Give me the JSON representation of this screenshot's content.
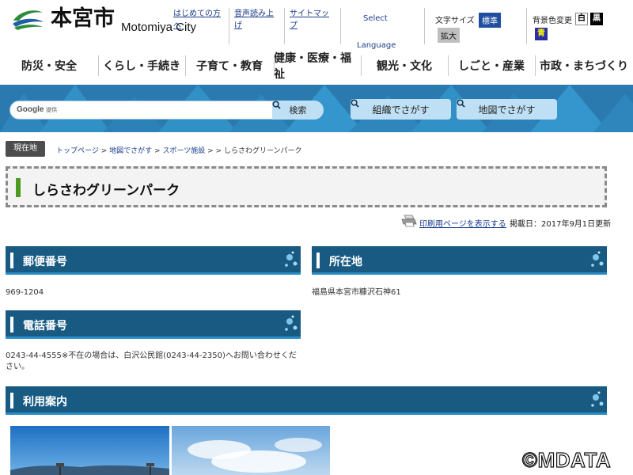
{
  "header": {
    "site_name_ja": "本宮市",
    "site_name_en": "Motomiya City",
    "util_links": [
      "はじめての方へ",
      "音声読み上げ",
      "サイトマップ"
    ],
    "language": {
      "top": "Select",
      "bottom": "Language"
    },
    "font_size": {
      "label": "文字サイズ",
      "standard": "標準",
      "large": "拡大"
    },
    "bg_color": {
      "label": "背景色変更",
      "white": "白",
      "black": "黒",
      "blue": "青"
    }
  },
  "nav": {
    "items": [
      "防災・安全",
      "くらし・手続き",
      "子育て・教育",
      "健康・医療・福祉",
      "観光・文化",
      "しごと・産業",
      "市政・まちづくり"
    ]
  },
  "search": {
    "provider": "Google",
    "provider_suffix": "提供",
    "button": "検索",
    "org_button": "組織でさがす",
    "map_button": "地図でさがす"
  },
  "breadcrumb": {
    "label": "現在地",
    "items": [
      "トップページ",
      "地図でさがす",
      "スポーツ施設"
    ],
    "current": "しらさわグリーンパーク",
    "separator": ">"
  },
  "page": {
    "title": "しらさわグリーンパーク",
    "print_link": "印刷用ページを表示する",
    "updated": "掲載日：2017年9月1日更新"
  },
  "sections": {
    "postal": {
      "heading": "郵便番号",
      "value": "969-1204"
    },
    "address": {
      "heading": "所在地",
      "value": "福島県本宮市糠沢石神61"
    },
    "phone": {
      "heading": "電話番号",
      "value": "0243-44-4555※不在の場合は、白沢公民館(0243-44-2350)へお問い合わせください。"
    },
    "usage": {
      "heading": "利用案内"
    }
  },
  "watermark": "©MDATA",
  "colors": {
    "band": "#2a7ab0",
    "section_head": "#185a82",
    "title_accent": "#4c9a20",
    "font_std": "#1f4f9e"
  }
}
